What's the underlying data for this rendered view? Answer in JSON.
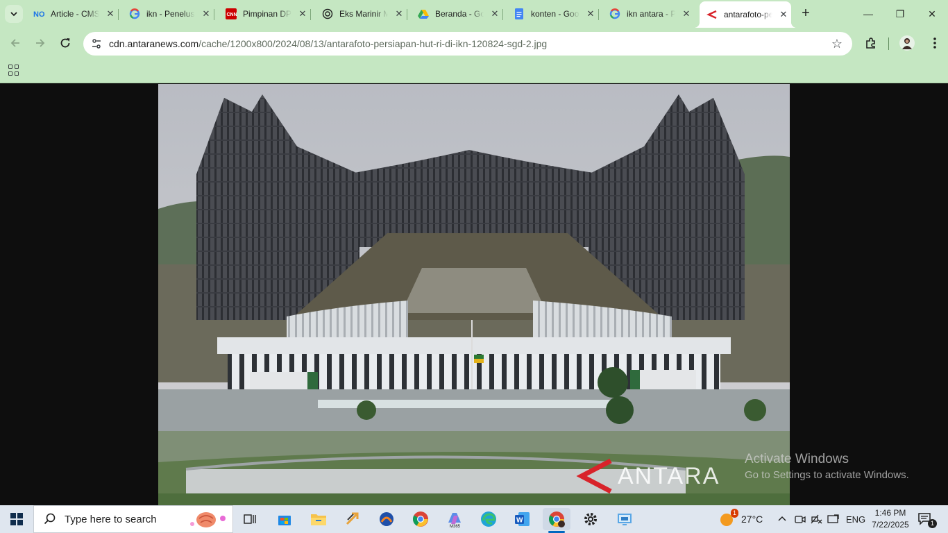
{
  "browser": {
    "tabs": [
      {
        "title": "Article - CMS",
        "icon": "cms-icon"
      },
      {
        "title": "ikn - Penelusuran Google",
        "icon": "google-icon"
      },
      {
        "title": "Pimpinan DPR",
        "icon": "cnn-icon"
      },
      {
        "title": "Eks Marinir M",
        "icon": "chatgpt-icon"
      },
      {
        "title": "Beranda - Google Drive",
        "icon": "drive-icon"
      },
      {
        "title": "konten - Google Docs",
        "icon": "docs-icon"
      },
      {
        "title": "ikn antara - Penelusuran Google",
        "icon": "google-icon"
      },
      {
        "title": "antarafoto-persiapan-hut-ri-di-ikn",
        "icon": "antara-icon"
      }
    ],
    "active_tab_index": 7,
    "close_glyph": "✕",
    "new_tab_glyph": "+",
    "url_host": "cdn.antaranews.com",
    "url_path": "/cache/1200x800/2024/08/13/antarafoto-persiapan-hut-ri-di-ikn-120824-sgd-2.jpg",
    "window_controls": {
      "minimize": "—",
      "restore": "❐",
      "close": "✕"
    }
  },
  "content": {
    "watermark_text": "ANTARA",
    "activation_title": "Activate Windows",
    "activation_subtitle": "Go to Settings to activate Windows."
  },
  "taskbar": {
    "search_placeholder": "Type here to search",
    "weather_temp": "27°C",
    "weather_badge": "1",
    "language": "ENG",
    "time": "1:46 PM",
    "date": "7/22/2025",
    "notification_count": "1",
    "apps": [
      "task-view",
      "microsoft-store",
      "file-explorer",
      "app-arrow",
      "vpn",
      "chrome",
      "microsoft-365",
      "edge",
      "word",
      "chrome-profile",
      "settings",
      "remote-desktop"
    ]
  },
  "colors": {
    "chrome_frame": "#c5e7c2",
    "taskbar": "#dfe6ef",
    "accent_blue": "#0067c0",
    "antara_red": "#d8232a"
  }
}
